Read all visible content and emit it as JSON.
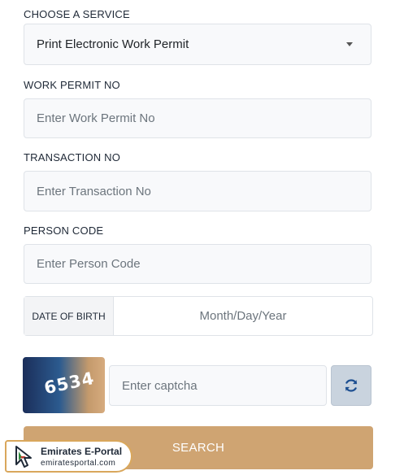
{
  "service": {
    "label": "CHOOSE A SERVICE",
    "selected": "Print Electronic Work Permit"
  },
  "work_permit": {
    "label": "WORK PERMIT NO",
    "placeholder": "Enter Work Permit No"
  },
  "transaction": {
    "label": "TRANSACTION NO",
    "placeholder": "Enter Transaction No"
  },
  "person_code": {
    "label": "PERSON CODE",
    "placeholder": "Enter Person Code"
  },
  "dob": {
    "label": "DATE OF BIRTH",
    "placeholder": "Month/Day/Year"
  },
  "captcha": {
    "code": "6534",
    "placeholder": "Enter captcha",
    "refresh_icon": "refresh-icon"
  },
  "search_button": "SEARCH",
  "watermark": {
    "title": "Emirates E-Portal",
    "url": "emiratesportal.com"
  },
  "colors": {
    "accent": "#cfa472",
    "refresh_bg": "#c9d3de",
    "refresh_icon": "#1d4f91"
  }
}
